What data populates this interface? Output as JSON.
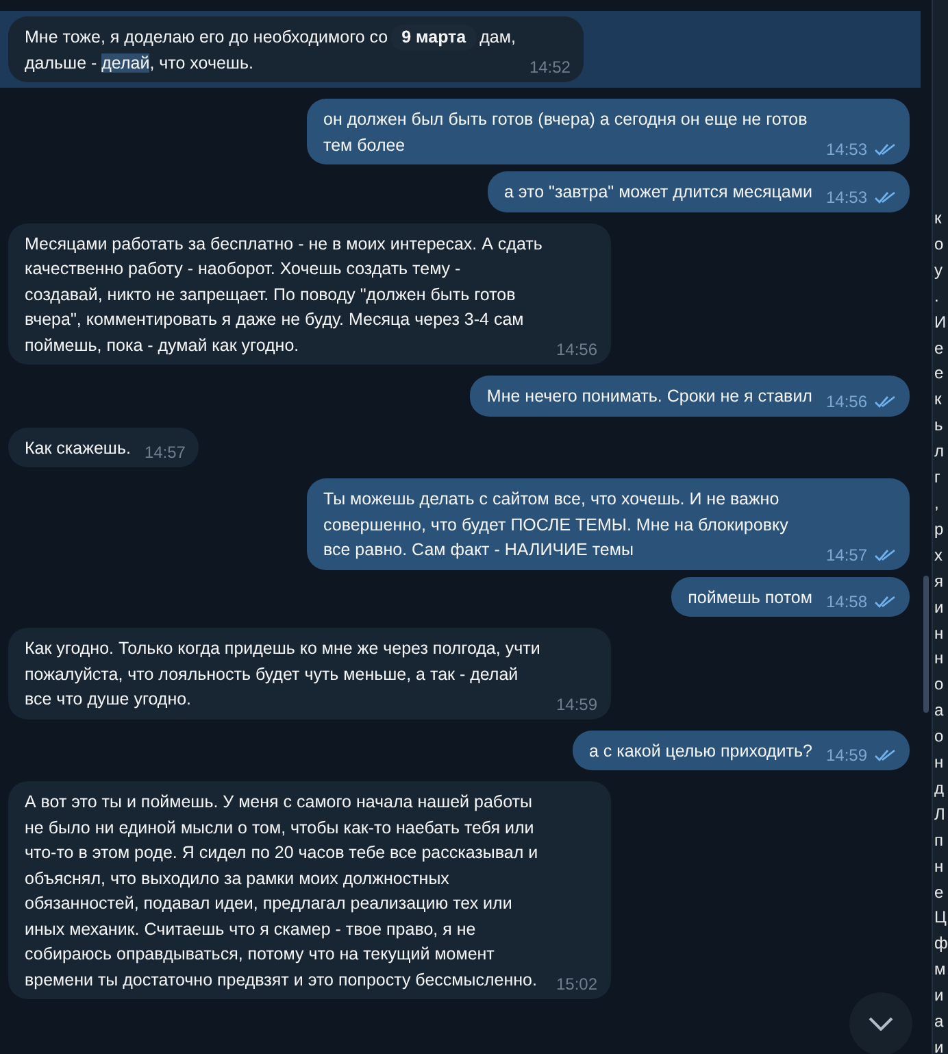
{
  "chat": {
    "date_badge": "9 марта",
    "messages": [
      {
        "kind": "segmented",
        "outgoing": false,
        "selected": true,
        "time": "14:52",
        "lines": [
          [
            {
              "text": "Мне тоже, я доделаю его до необходимого со",
              "highlighted": false
            },
            {
              "text": "дам,",
              "highlighted": false,
              "after_badge": true
            }
          ],
          [
            {
              "text": "дальше - ",
              "highlighted": false
            },
            {
              "text": "делай",
              "highlighted": true
            },
            {
              "text": ", что хочешь.",
              "highlighted": false
            }
          ]
        ]
      },
      {
        "kind": "plain",
        "outgoing": true,
        "selected": false,
        "time": "14:53",
        "read": true,
        "text": "он должен был быть готов (вчера) а сегодня он еще не готов тем более"
      },
      {
        "kind": "plain",
        "outgoing": true,
        "selected": false,
        "time": "14:53",
        "read": true,
        "text": "а это \"завтра\" может длится месяцами"
      },
      {
        "kind": "plain",
        "outgoing": false,
        "selected": false,
        "time": "14:56",
        "text": "Месяцами работать за бесплатно - не в моих интересах. А сдать качественно работу - наоборот. Хочешь создать тему - создавай, никто не запрещает. По поводу \"должен быть готов вчера\", комментировать я даже не буду. Месяца через 3-4 сам поймешь, пока - думай как угодно."
      },
      {
        "kind": "plain",
        "outgoing": true,
        "selected": false,
        "time": "14:56",
        "read": true,
        "text": "Мне нечего понимать. Сроки не я ставил"
      },
      {
        "kind": "plain",
        "outgoing": false,
        "selected": false,
        "time": "14:57",
        "text": "Как скажешь."
      },
      {
        "kind": "plain",
        "outgoing": true,
        "selected": false,
        "time": "14:57",
        "read": true,
        "text": "Ты можешь делать с сайтом все, что хочешь. И не важно совершенно, что будет ПОСЛЕ ТЕМЫ. Мне на блокировку все равно. Сам факт - НАЛИЧИЕ темы"
      },
      {
        "kind": "plain",
        "outgoing": true,
        "selected": false,
        "time": "14:58",
        "read": true,
        "text": "поймешь потом"
      },
      {
        "kind": "plain",
        "outgoing": false,
        "selected": false,
        "time": "14:59",
        "text": "Как угодно. Только когда придешь ко мне же через полгода, учти пожалуйста, что лояльность будет чуть меньше, а так - делай все что душе угодно."
      },
      {
        "kind": "plain",
        "outgoing": true,
        "selected": false,
        "time": "14:59",
        "read": true,
        "text": "а с какой целью приходить?"
      },
      {
        "kind": "plain",
        "outgoing": false,
        "selected": false,
        "time": "15:02",
        "text": "А вот это ты и поймешь. У меня с самого начала нашей работы не было ни единой мысли о том, чтобы как-то наебать тебя или что-то в этом роде. Я сидел по 20 часов тебе все рассказывал и объяснял, что выходило за рамки моих должностных обязанностей, подавал идеи, предлагал реализацию тех или иных механик. Считаешь что я скамер - твое право, я не собираюсь оправдываться, потому что на текущий момент времени ты достаточно предвзят и это попросту бессмысленно."
      }
    ]
  },
  "side_panel": {
    "fragments": [
      "к",
      "о",
      "у",
      ".",
      "И",
      "е",
      "е",
      "к",
      "ь",
      "л",
      "г",
      ",",
      "р",
      "х",
      "я",
      "и",
      "н",
      "н",
      "о",
      "а",
      "о",
      "н",
      "д",
      "Л",
      "п",
      "н",
      "е",
      "Ц",
      "ф",
      "м",
      "и",
      "а",
      "и"
    ]
  }
}
